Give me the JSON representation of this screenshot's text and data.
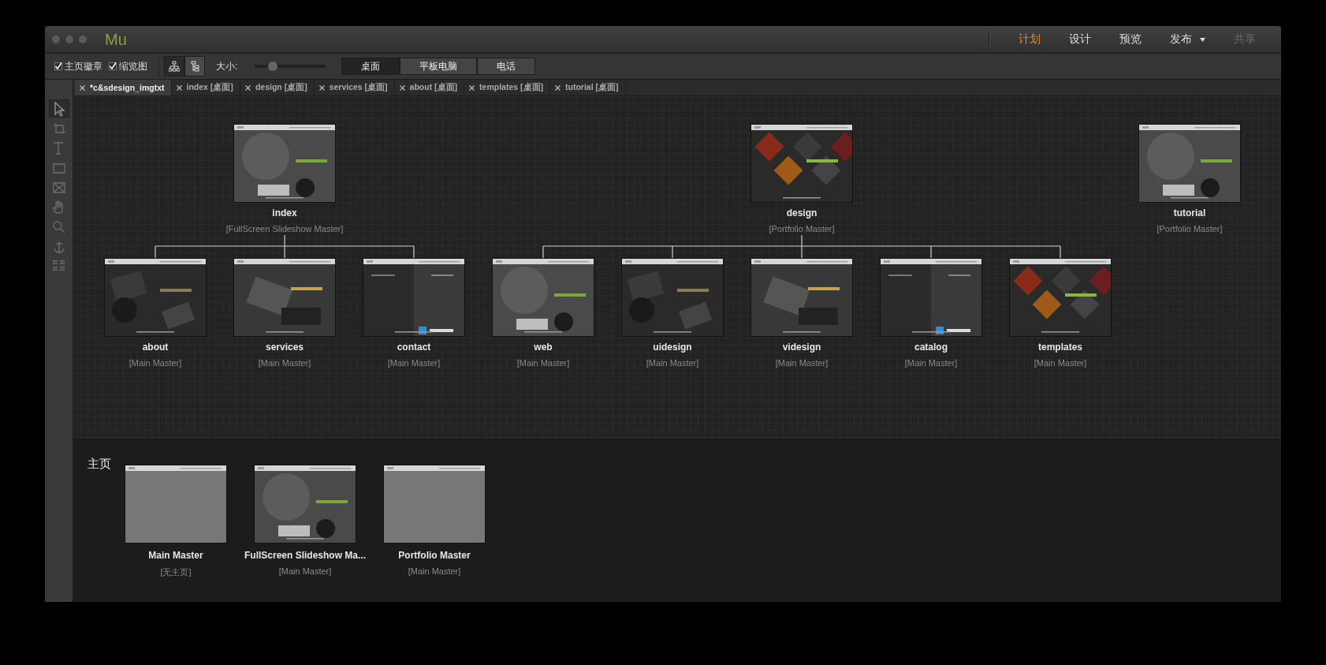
{
  "window": {
    "app_name": "Mu"
  },
  "modes": [
    {
      "label": "计划",
      "selected": true,
      "disabled": false,
      "menu": false
    },
    {
      "label": "设计",
      "selected": false,
      "disabled": false,
      "menu": false
    },
    {
      "label": "预览",
      "selected": false,
      "disabled": false,
      "menu": false
    },
    {
      "label": "发布",
      "selected": false,
      "disabled": false,
      "menu": true
    },
    {
      "label": "共享",
      "selected": false,
      "disabled": true,
      "menu": false
    }
  ],
  "toolbar": {
    "checkboxes": [
      {
        "label": "主页徽章",
        "checked": true
      },
      {
        "label": "缩览图",
        "checked": true
      }
    ],
    "view_buttons": [
      {
        "selected": false
      },
      {
        "selected": true
      }
    ],
    "size": {
      "label": "大小:",
      "level": 0.25
    },
    "devices": [
      {
        "label": "桌面",
        "selected": true
      },
      {
        "label": "平板电脑",
        "selected": false
      },
      {
        "label": "电话",
        "selected": false
      }
    ]
  },
  "tabs": [
    {
      "label": "*c&sdesign_imgtxt",
      "selected": true
    },
    {
      "label": "index [桌面]",
      "selected": false
    },
    {
      "label": "design [桌面]",
      "selected": false
    },
    {
      "label": "services [桌面]",
      "selected": false
    },
    {
      "label": "about [桌面]",
      "selected": false
    },
    {
      "label": "templates [桌面]",
      "selected": false
    },
    {
      "label": "tutorial [桌面]",
      "selected": false
    }
  ],
  "tools": [
    {
      "selected": true
    },
    {
      "selected": false
    },
    {
      "selected": false
    },
    {
      "selected": false
    },
    {
      "selected": false
    },
    {
      "selected": false
    },
    {
      "selected": false
    },
    {
      "selected": false
    },
    {
      "selected": false
    }
  ],
  "sitemap": {
    "pages": [
      {
        "name": "index",
        "master": "[FullScreen Slideshow Master]",
        "children": [
          {
            "name": "about",
            "master": "[Main Master]"
          },
          {
            "name": "services",
            "master": "[Main Master]"
          },
          {
            "name": "contact",
            "master": "[Main Master]"
          }
        ]
      },
      {
        "name": "design",
        "master": "[Portfolio Master]",
        "children": [
          {
            "name": "web",
            "master": "[Main Master]"
          },
          {
            "name": "uidesign",
            "master": "[Main Master]"
          },
          {
            "name": "videsign",
            "master": "[Main Master]"
          },
          {
            "name": "catalog",
            "master": "[Main Master]"
          },
          {
            "name": "templates",
            "master": "[Main Master]"
          }
        ]
      },
      {
        "name": "tutorial",
        "master": "[Portfolio Master]"
      }
    ]
  },
  "masters": {
    "title": "主页",
    "items": [
      {
        "name": "Main Master",
        "master": "[无主页]",
        "kind": "blank"
      },
      {
        "name": "FullScreen Slideshow Ma...",
        "master": "[Main Master]",
        "kind": "picture"
      },
      {
        "name": "Portfolio Master",
        "master": "[Main Master]",
        "kind": "blank"
      }
    ]
  }
}
